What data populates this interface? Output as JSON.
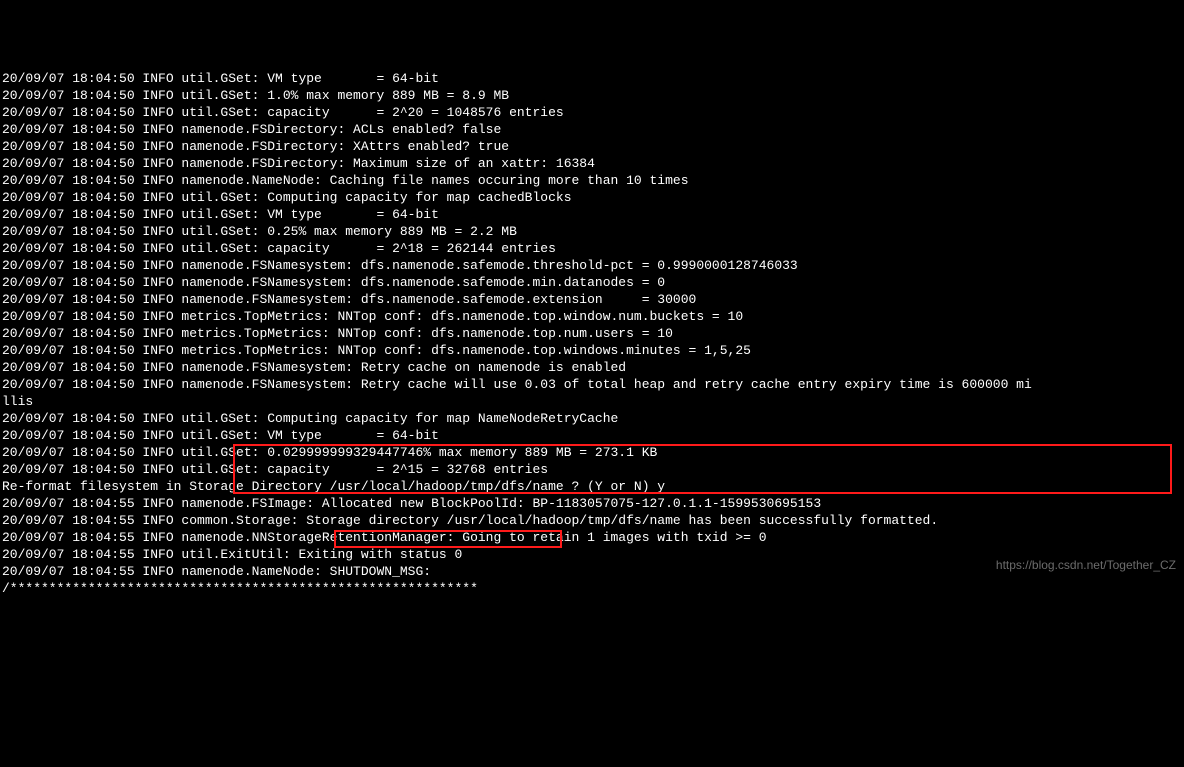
{
  "lines": [
    "20/09/07 18:04:50 INFO util.GSet: VM type       = 64-bit",
    "20/09/07 18:04:50 INFO util.GSet: 1.0% max memory 889 MB = 8.9 MB",
    "20/09/07 18:04:50 INFO util.GSet: capacity      = 2^20 = 1048576 entries",
    "20/09/07 18:04:50 INFO namenode.FSDirectory: ACLs enabled? false",
    "20/09/07 18:04:50 INFO namenode.FSDirectory: XAttrs enabled? true",
    "20/09/07 18:04:50 INFO namenode.FSDirectory: Maximum size of an xattr: 16384",
    "20/09/07 18:04:50 INFO namenode.NameNode: Caching file names occuring more than 10 times",
    "20/09/07 18:04:50 INFO util.GSet: Computing capacity for map cachedBlocks",
    "20/09/07 18:04:50 INFO util.GSet: VM type       = 64-bit",
    "20/09/07 18:04:50 INFO util.GSet: 0.25% max memory 889 MB = 2.2 MB",
    "20/09/07 18:04:50 INFO util.GSet: capacity      = 2^18 = 262144 entries",
    "20/09/07 18:04:50 INFO namenode.FSNamesystem: dfs.namenode.safemode.threshold-pct = 0.9990000128746033",
    "20/09/07 18:04:50 INFO namenode.FSNamesystem: dfs.namenode.safemode.min.datanodes = 0",
    "20/09/07 18:04:50 INFO namenode.FSNamesystem: dfs.namenode.safemode.extension     = 30000",
    "20/09/07 18:04:50 INFO metrics.TopMetrics: NNTop conf: dfs.namenode.top.window.num.buckets = 10",
    "20/09/07 18:04:50 INFO metrics.TopMetrics: NNTop conf: dfs.namenode.top.num.users = 10",
    "20/09/07 18:04:50 INFO metrics.TopMetrics: NNTop conf: dfs.namenode.top.windows.minutes = 1,5,25",
    "20/09/07 18:04:50 INFO namenode.FSNamesystem: Retry cache on namenode is enabled",
    "20/09/07 18:04:50 INFO namenode.FSNamesystem: Retry cache will use 0.03 of total heap and retry cache entry expiry time is 600000 mi",
    "llis",
    "20/09/07 18:04:50 INFO util.GSet: Computing capacity for map NameNodeRetryCache",
    "20/09/07 18:04:50 INFO util.GSet: VM type       = 64-bit",
    "20/09/07 18:04:50 INFO util.GSet: 0.029999999329447746% max memory 889 MB = 273.1 KB",
    "20/09/07 18:04:50 INFO util.GSet: capacity      = 2^15 = 32768 entries",
    "Re-format filesystem in Storage Directory /usr/local/hadoop/tmp/dfs/name ? (Y or N) y",
    "20/09/07 18:04:55 INFO namenode.FSImage: Allocated new BlockPoolId: BP-1183057075-127.0.1.1-1599530695153",
    "20/09/07 18:04:55 INFO common.Storage: Storage directory /usr/local/hadoop/tmp/dfs/name has been successfully formatted.",
    "20/09/07 18:04:55 INFO namenode.NNStorageRetentionManager: Going to retain 1 images with txid >= 0",
    "20/09/07 18:04:55 INFO util.ExitUtil: Exiting with status 0",
    "20/09/07 18:04:55 INFO namenode.NameNode: SHUTDOWN_MSG:",
    "/************************************************************"
  ],
  "watermark": "https://blog.csdn.net/Together_CZ"
}
